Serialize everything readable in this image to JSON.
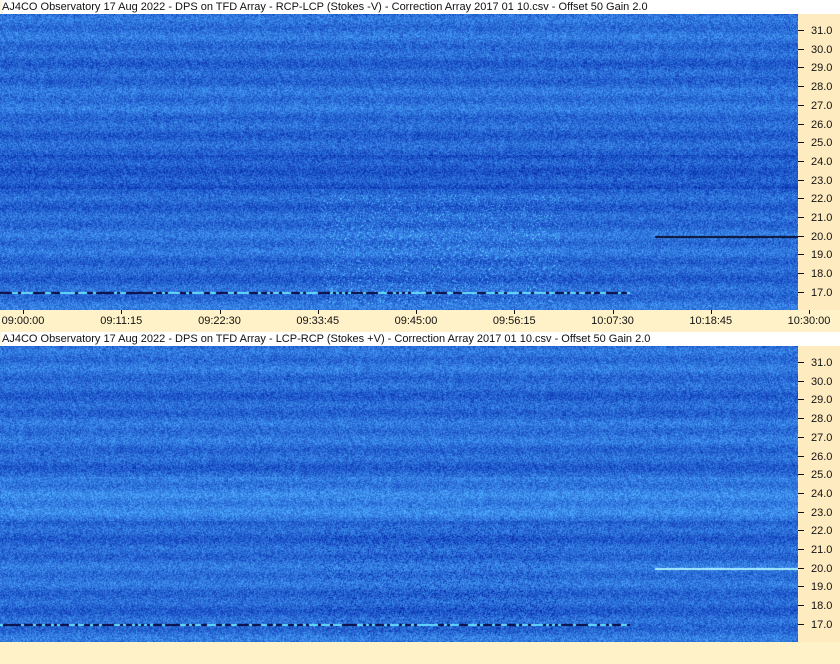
{
  "panels": [
    {
      "title": "AJ4CO Observatory 17 Aug 2022  -  DPS on TFD Array  -  RCP-LCP (Stokes -V)  -  Correction Array 2017 01 10.csv  -  Offset 50  Gain 2.0"
    },
    {
      "title": "AJ4CO Observatory 17 Aug 2022  -  DPS on TFD Array  -  LCP-RCP (Stokes +V)  -  Correction Array 2017 01 10.csv  -  Offset 50  Gain 2.0"
    }
  ],
  "y_ticks": [
    "31.0",
    "30.0",
    "29.0",
    "28.0",
    "27.0",
    "26.0",
    "25.0",
    "24.0",
    "23.0",
    "22.0",
    "21.0",
    "20.0",
    "19.0",
    "18.0",
    "17.0"
  ],
  "x_ticks": [
    "09:00:00",
    "09:11:15",
    "09:22:30",
    "09:33:45",
    "09:45:00",
    "09:56:15",
    "10:07:30",
    "10:18:45",
    "10:30:00"
  ],
  "colors": {
    "plot_bg": "#2255dd",
    "plot_dark": "#1435b0",
    "plot_light": "#58a8f0",
    "axis_bg": "#ffebc0",
    "title_bg": "#ffffff"
  }
}
